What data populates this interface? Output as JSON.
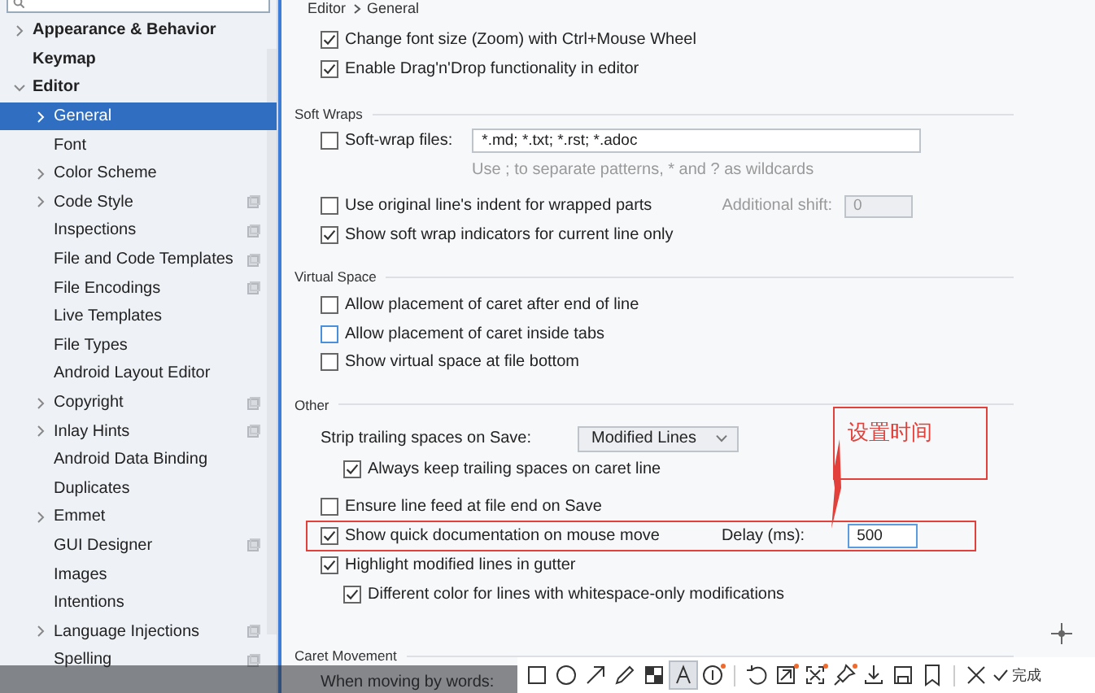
{
  "sidebar": {
    "items": [
      {
        "label": "Appearance & Behavior",
        "selected": false,
        "expanded": false,
        "bold": true
      },
      {
        "label": "Keymap",
        "selected": false,
        "bold": true
      },
      {
        "label": "Editor",
        "selected": false,
        "expanded": true,
        "bold": true,
        "children": [
          {
            "label": "General",
            "selected": true,
            "expanded": false
          },
          {
            "label": "Font",
            "selected": false
          },
          {
            "label": "Color Scheme",
            "selected": false,
            "expanded": false
          },
          {
            "label": "Code Style",
            "selected": false,
            "expanded": false,
            "project": true
          },
          {
            "label": "Inspections",
            "selected": false,
            "project": true
          },
          {
            "label": "File and Code Templates",
            "selected": false,
            "project": true
          },
          {
            "label": "File Encodings",
            "selected": false,
            "project": true
          },
          {
            "label": "Live Templates",
            "selected": false
          },
          {
            "label": "File Types",
            "selected": false
          },
          {
            "label": "Android Layout Editor",
            "selected": false
          },
          {
            "label": "Copyright",
            "selected": false,
            "expanded": false,
            "project": true
          },
          {
            "label": "Inlay Hints",
            "selected": false,
            "expanded": false,
            "project": true
          },
          {
            "label": "Android Data Binding",
            "selected": false
          },
          {
            "label": "Duplicates",
            "selected": false
          },
          {
            "label": "Emmet",
            "selected": false,
            "expanded": false
          },
          {
            "label": "GUI Designer",
            "selected": false,
            "project": true
          },
          {
            "label": "Images",
            "selected": false
          },
          {
            "label": "Intentions",
            "selected": false
          },
          {
            "label": "Language Injections",
            "selected": false,
            "expanded": false,
            "project": true
          },
          {
            "label": "Spelling",
            "selected": false,
            "project": true
          }
        ]
      }
    ]
  },
  "main": {
    "breadcrumb": [
      "Editor",
      "General"
    ],
    "top_rows": [
      {
        "kind": "checkbox",
        "label": "Change font size (Zoom) with Ctrl+Mouse Wheel",
        "checked": true
      },
      {
        "kind": "checkbox",
        "label": "Enable Drag'n'Drop functionality in editor",
        "checked": true
      }
    ],
    "sections": [
      {
        "title": "Soft Wraps",
        "rows": [
          {
            "kind": "field",
            "label": "Soft-wrap files:",
            "checked": false,
            "value": "*.md; *.txt; *.rst; *.adoc"
          },
          {
            "kind": "hint",
            "label": "Use ; to separate patterns, * and ? as wildcards"
          },
          {
            "kind": "shift",
            "label": "Use original line's indent for wrapped parts",
            "checked": false,
            "shift_label": "Additional shift:",
            "shift_value": "0",
            "disabled": true
          },
          {
            "kind": "checkbox",
            "label": "Show soft wrap indicators for current line only",
            "checked": true
          }
        ]
      },
      {
        "title": "Virtual Space",
        "rows": [
          {
            "kind": "checkbox",
            "label": "Allow placement of caret after end of line",
            "checked": false
          },
          {
            "kind": "checkbox",
            "label": "Allow placement of caret inside tabs",
            "checked": false,
            "focused": true
          },
          {
            "kind": "checkbox",
            "label": "Show virtual space at file bottom",
            "checked": false
          }
        ]
      },
      {
        "title": "Other",
        "rows": [
          {
            "kind": "dropdown",
            "label": "Strip trailing spaces on Save:",
            "value": "Modified Lines"
          },
          {
            "kind": "checkbox",
            "label": "Always keep trailing spaces on caret line",
            "checked": true,
            "indented": true
          },
          {
            "kind": "checkbox",
            "label": "Ensure line feed at file end on Save",
            "checked": false
          },
          {
            "kind": "delay",
            "label": "Show quick documentation on mouse move",
            "checked": true,
            "delay_label": "Delay (ms):",
            "value": "500",
            "annotated": true
          },
          {
            "kind": "checkbox",
            "label": "Highlight modified lines in gutter",
            "checked": true
          },
          {
            "kind": "checkbox",
            "label": "Different color for lines with whitespace-only modifications",
            "checked": true,
            "indented": true
          }
        ]
      },
      {
        "title": "Caret Movement",
        "rows": [
          {
            "kind": "label",
            "label": "When moving by words:"
          }
        ]
      }
    ]
  },
  "annotation": {
    "text": "设置时间"
  },
  "toolbar": {
    "tools": [
      {
        "kind": "rectangle",
        "selected": false
      },
      {
        "kind": "ellipse",
        "selected": false
      },
      {
        "kind": "arrow",
        "selected": false
      },
      {
        "kind": "pencil",
        "selected": false
      },
      {
        "kind": "mosaic",
        "selected": false
      },
      {
        "kind": "text",
        "selected": true
      },
      {
        "kind": "number",
        "selected": false,
        "dot": true
      }
    ],
    "actions": [
      {
        "kind": "undo"
      },
      {
        "kind": "scan",
        "dot": true
      },
      {
        "kind": "expand",
        "dot": true
      },
      {
        "kind": "pin",
        "dot": true
      },
      {
        "kind": "download"
      },
      {
        "kind": "save"
      },
      {
        "kind": "bookmark"
      },
      {
        "kind": "cancel"
      }
    ],
    "done_label": "完成"
  }
}
